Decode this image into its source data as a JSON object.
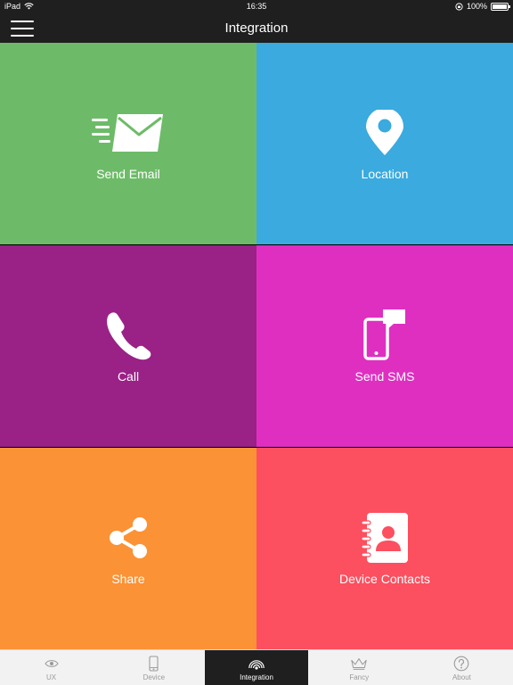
{
  "status_bar": {
    "device": "iPad",
    "time": "16:35",
    "battery": "100%",
    "battery_level": 1.0
  },
  "nav": {
    "title": "Integration",
    "menu_icon": "hamburger-menu-icon"
  },
  "tiles": [
    {
      "label": "Send Email",
      "icon": "email-icon",
      "color": "#6dbb68"
    },
    {
      "label": "Location",
      "icon": "location-pin-icon",
      "color": "#3aaadf"
    },
    {
      "label": "Call",
      "icon": "phone-icon",
      "color": "#9a2186"
    },
    {
      "label": "Send SMS",
      "icon": "sms-icon",
      "color": "#df2fc1"
    },
    {
      "label": "Share",
      "icon": "share-icon",
      "color": "#fb9235"
    },
    {
      "label": "Device Contacts",
      "icon": "contacts-icon",
      "color": "#fc4f5f"
    }
  ],
  "tab_bar": {
    "active_index": 2,
    "tabs": [
      {
        "label": "UX",
        "icon": "eye-icon"
      },
      {
        "label": "Device",
        "icon": "device-icon"
      },
      {
        "label": "Integration",
        "icon": "integration-icon"
      },
      {
        "label": "Fancy",
        "icon": "crown-icon"
      },
      {
        "label": "About",
        "icon": "question-icon"
      }
    ]
  }
}
